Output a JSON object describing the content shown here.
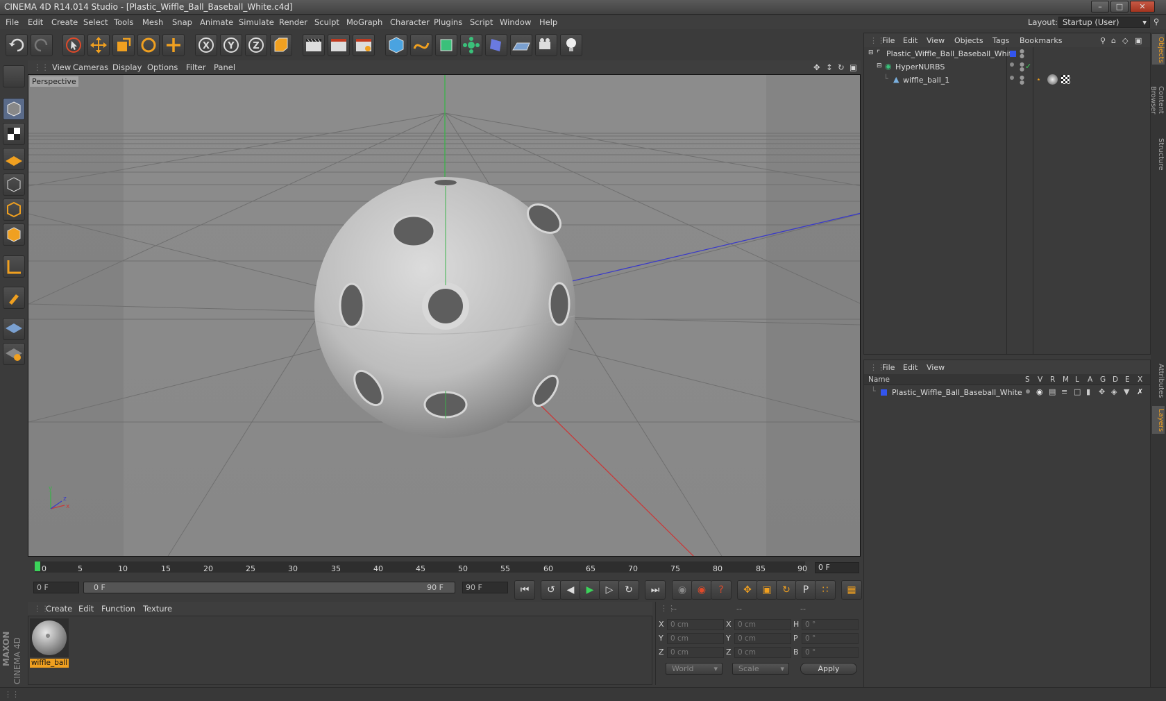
{
  "window": {
    "title": "CINEMA 4D R14.014 Studio - [Plastic_Wiffle_Ball_Baseball_White.c4d]"
  },
  "menu": [
    "File",
    "Edit",
    "Create",
    "Select",
    "Tools",
    "Mesh",
    "Snap",
    "Animate",
    "Simulate",
    "Render",
    "Sculpt",
    "MoGraph",
    "Character",
    "Plugins",
    "Script",
    "Window",
    "Help"
  ],
  "layout": {
    "label": "Layout:",
    "value": "Startup (User)"
  },
  "viewport": {
    "menu": [
      "View",
      "Cameras",
      "Display",
      "Options",
      "Filter",
      "Panel"
    ],
    "label": "Perspective"
  },
  "timeline": {
    "ticks": [
      "0",
      "5",
      "10",
      "15",
      "20",
      "25",
      "30",
      "35",
      "40",
      "45",
      "50",
      "55",
      "60",
      "65",
      "70",
      "75",
      "80",
      "85",
      "90"
    ],
    "current_frame": "0 F",
    "start_field": "0 F",
    "range_start": "0 F",
    "range_end": "90 F",
    "end_field": "90 F"
  },
  "material_manager": {
    "menu": [
      "Create",
      "Edit",
      "Function",
      "Texture"
    ],
    "materials": [
      {
        "name": "wiffle_ball"
      }
    ]
  },
  "coordinates": {
    "header": [
      "--",
      "--",
      "--"
    ],
    "rows": [
      {
        "a": "X",
        "av": "0 cm",
        "b": "X",
        "bv": "0 cm",
        "c": "H",
        "cv": "0 °"
      },
      {
        "a": "Y",
        "av": "0 cm",
        "b": "Y",
        "bv": "0 cm",
        "c": "P",
        "cv": "0 °"
      },
      {
        "a": "Z",
        "av": "0 cm",
        "b": "Z",
        "bv": "0 cm",
        "c": "B",
        "cv": "0 °"
      }
    ],
    "mode": "World",
    "type": "Scale",
    "apply": "Apply"
  },
  "object_manager": {
    "menu": [
      "File",
      "Edit",
      "View",
      "Objects",
      "Tags",
      "Bookmarks"
    ],
    "objects": [
      {
        "name": "Plastic_Wiffle_Ball_Baseball_White"
      },
      {
        "name": "HyperNURBS"
      },
      {
        "name": "wiffle_ball_1"
      }
    ]
  },
  "layer_manager": {
    "menu": [
      "File",
      "Edit",
      "View"
    ],
    "columns": [
      "Name",
      "S",
      "V",
      "R",
      "M",
      "L",
      "A",
      "G",
      "D",
      "E",
      "X"
    ],
    "layers": [
      {
        "name": "Plastic_Wiffle_Ball_Baseball_White"
      }
    ]
  },
  "side_tabs": [
    "Objects",
    "Content Browser",
    "Structure",
    "Attributes",
    "Layers"
  ],
  "branding": {
    "maxon": "MAXON",
    "product": "CINEMA 4D"
  }
}
